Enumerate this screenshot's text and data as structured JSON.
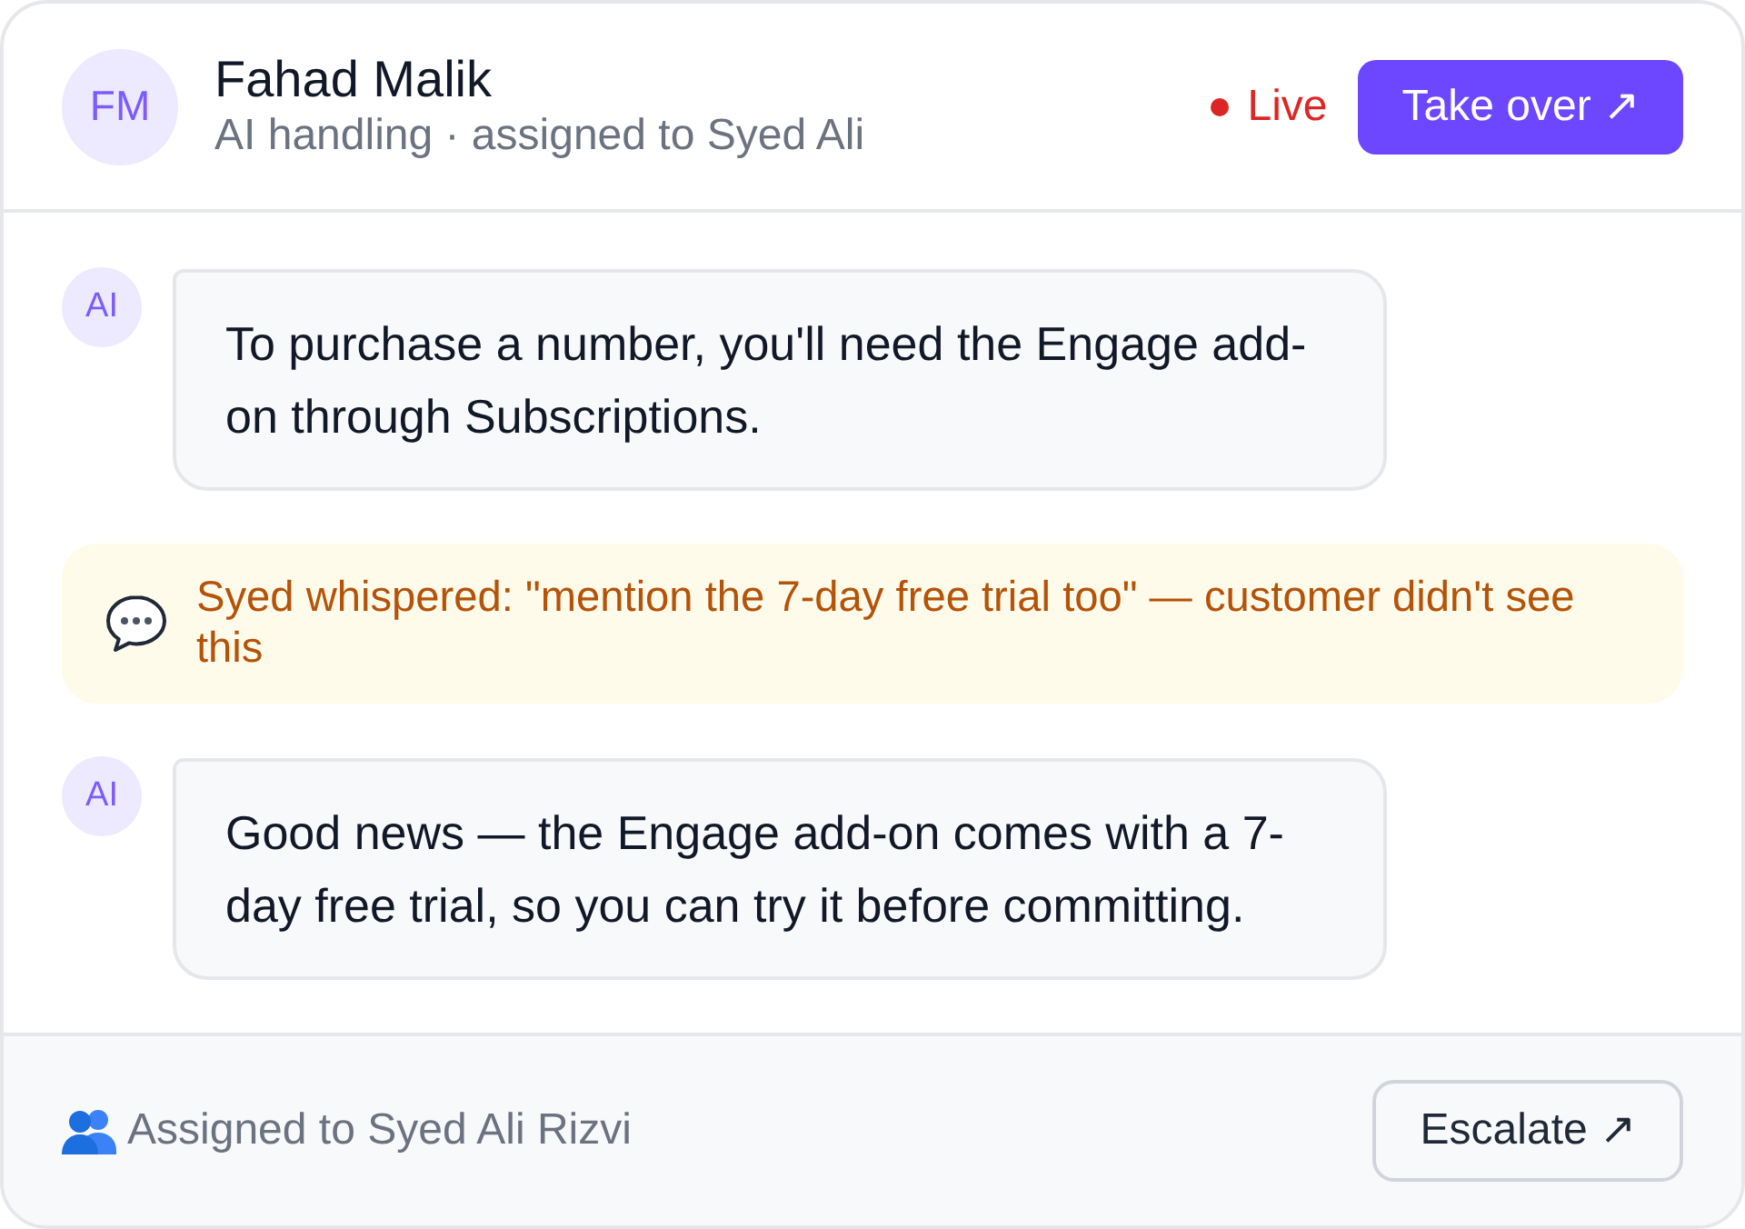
{
  "header": {
    "avatar_initials": "FM",
    "name": "Fahad Malik",
    "subtitle": "AI handling · assigned to Syed Ali",
    "status": {
      "label": "Live",
      "live": true
    },
    "action_button": "Take over ↗"
  },
  "messages": [
    {
      "kind": "ai",
      "avatar": "AI",
      "text": "To purchase a number, you'll need the Engage add-on through Subscriptions."
    },
    {
      "kind": "whisper",
      "text": "Syed whispered: \"mention the 7-day free trial too\" — customer didn't see this"
    },
    {
      "kind": "ai",
      "avatar": "AI",
      "text": "Good news — the Engage add-on comes with a 7-day free trial, so you can try it before committing."
    }
  ],
  "footer": {
    "assignment": "Assigned to Syed Ali Rizvi",
    "button": "Escalate ↗"
  }
}
